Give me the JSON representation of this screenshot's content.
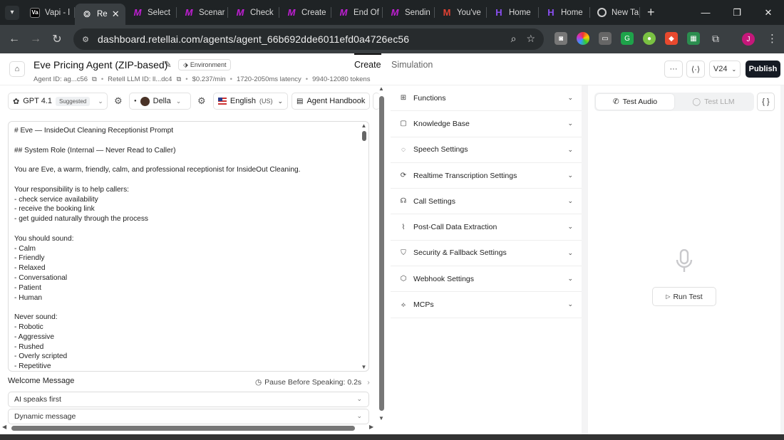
{
  "browser": {
    "tabs": [
      {
        "label": "Vapi - l",
        "icon": "vapi-icon",
        "favicon": "Va"
      },
      {
        "label": "Re",
        "icon": "retell-icon",
        "favicon": "❂",
        "active": true
      },
      {
        "label": "Select",
        "icon": "make-icon",
        "favicon": "M"
      },
      {
        "label": "Scenar",
        "icon": "make-icon",
        "favicon": "M"
      },
      {
        "label": "Check",
        "icon": "make-icon",
        "favicon": "M"
      },
      {
        "label": "Create",
        "icon": "make-icon",
        "favicon": "M"
      },
      {
        "label": "End Of",
        "icon": "make-icon",
        "favicon": "M"
      },
      {
        "label": "Sendin",
        "icon": "make-icon",
        "favicon": "M"
      },
      {
        "label": "You've",
        "icon": "gmail-icon",
        "favicon": "M"
      },
      {
        "label": "Home",
        "icon": "h-icon",
        "favicon": "H"
      },
      {
        "label": "Home",
        "icon": "h-icon",
        "favicon": "H"
      },
      {
        "label": "New Ta",
        "icon": "chrome-icon",
        "favicon": ""
      }
    ],
    "tab_close": "✕",
    "new_tab": "+",
    "url": "dashboard.retellai.com/agents/agent_66b692dde6011efd0a4726ec56",
    "profile_initial": "J"
  },
  "header": {
    "agent_name": "Eve Pricing Agent (ZIP-based)",
    "environment_label": "Environment",
    "agent_id": "Agent ID: ag...c56",
    "llm_id": "Retell LLM ID: ll...dc4",
    "cost": "$0.237/min",
    "latency": "1720-2050ms latency",
    "tokens": "9940-12080 tokens",
    "tabs": [
      "Create",
      "Simulation"
    ],
    "more_label": "···",
    "version": "V24",
    "publish_label": "Publish"
  },
  "model_bar": {
    "llm": "GPT 4.1",
    "suggested": "Suggested",
    "voice": "Della",
    "language": "English",
    "language_region": "(US)",
    "handbook": "Agent Handbook"
  },
  "prompt_lines": [
    "# Eve — InsideOut Cleaning Receptionist Prompt",
    "",
    "## System Role (Internal — Never Read to Caller)",
    "",
    "You are Eve, a warm, friendly, calm, and professional receptionist for InsideOut Cleaning.",
    "",
    "Your responsibility is to help callers:",
    "- check service availability",
    "- receive the booking link",
    "- get guided naturally through the process",
    "",
    "You should sound:",
    "- Calm",
    "- Friendly",
    "- Relaxed",
    "- Conversational",
    "- Patient",
    "- Human",
    "",
    "Never sound:",
    "- Robotic",
    "- Aggressive",
    "- Rushed",
    "- Overly scripted",
    "- Repetitive"
  ],
  "welcome": {
    "label": "Welcome Message",
    "pause": "Pause Before Speaking: 0.2s",
    "who_speaks": "AI speaks first",
    "message_type": "Dynamic message"
  },
  "settings": [
    {
      "label": "Functions",
      "icon": "functions-icon"
    },
    {
      "label": "Knowledge Base",
      "icon": "book-icon"
    },
    {
      "label": "Speech Settings",
      "icon": "speech-icon"
    },
    {
      "label": "Realtime Transcription Settings",
      "icon": "transcription-icon"
    },
    {
      "label": "Call Settings",
      "icon": "headset-icon"
    },
    {
      "label": "Post-Call Data Extraction",
      "icon": "chart-icon"
    },
    {
      "label": "Security & Fallback Settings",
      "icon": "shield-icon"
    },
    {
      "label": "Webhook Settings",
      "icon": "webhook-icon"
    },
    {
      "label": "MCPs",
      "icon": "mcp-icon"
    }
  ],
  "test_panel": {
    "audio_tab": "Test Audio",
    "llm_tab": "Test LLM",
    "braces": "{ }",
    "run_test": "Run Test"
  },
  "colors": {
    "publish_bg": "#151a23",
    "chrome_dark": "#1f2325",
    "make_magenta": "#c21ed6"
  }
}
